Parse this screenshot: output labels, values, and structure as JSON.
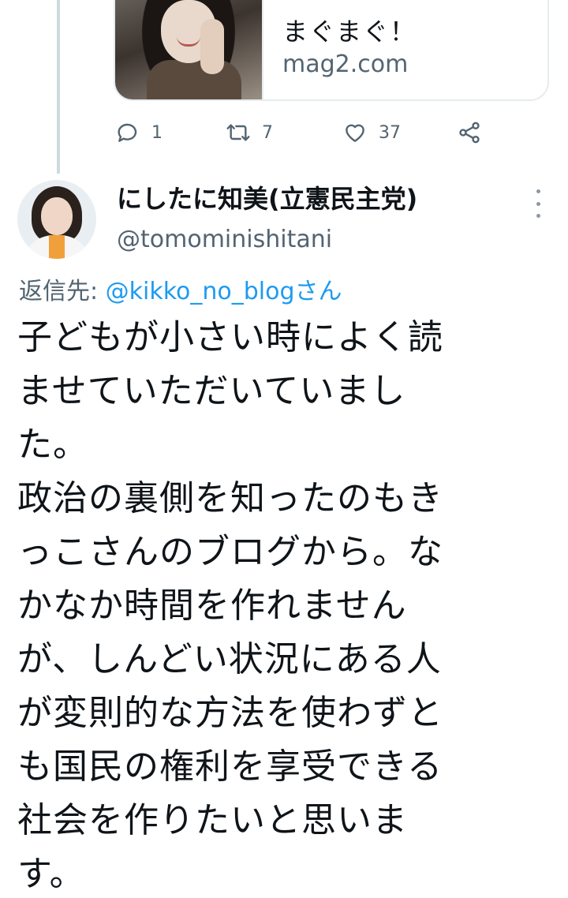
{
  "link_card": {
    "title": "まぐまぐ！",
    "domain": "mag2.com"
  },
  "actions": {
    "reply_count": "1",
    "retweet_count": "7",
    "like_count": "37"
  },
  "tweet": {
    "display_name": "にしたに知美(立憲民主党)",
    "handle": "@tomominishitani",
    "reply_to_label": "返信先: ",
    "reply_to_mention": "@kikko_no_blogさん",
    "body_lines": [
      "子どもが小さい時によく読",
      "ませていただいていまし",
      "た。",
      "政治の裏側を知ったのもき",
      "っこさんのブログから。な",
      "かなか時間を作れません",
      "が、しんどい状況にある人",
      "が変則的な方法を使わずと",
      "も国民の権利を享受できる",
      "社会を作りたいと思いま",
      "す。"
    ]
  },
  "colors": {
    "text": "#0f1419",
    "secondary": "#536471",
    "link": "#1d9bf0",
    "border": "#e6ecf0"
  },
  "icons": [
    "reply-icon",
    "retweet-icon",
    "like-icon",
    "share-icon",
    "more-icon"
  ]
}
